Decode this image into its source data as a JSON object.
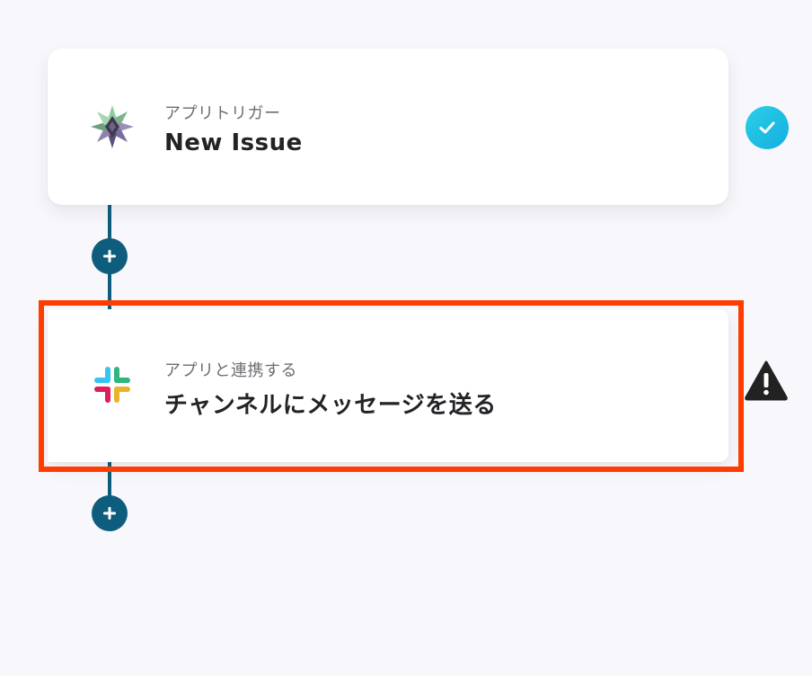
{
  "flow": {
    "steps": [
      {
        "label": "アプリトリガー",
        "title": "New Issue",
        "app_icon": "star-app-icon",
        "status": "completed",
        "status_icon": "check-circle-icon",
        "status_color": "#1bbde2"
      },
      {
        "label": "アプリと連携する",
        "title": "チャンネルにメッセージを送る",
        "app_icon": "slack-icon",
        "status": "warning",
        "status_icon": "warning-triangle-icon",
        "status_color": "#222222",
        "highlighted": true,
        "highlight_color": "#ff3d00"
      }
    ],
    "connector_color": "#0f5d7d",
    "add_step_icon": "plus-icon"
  }
}
